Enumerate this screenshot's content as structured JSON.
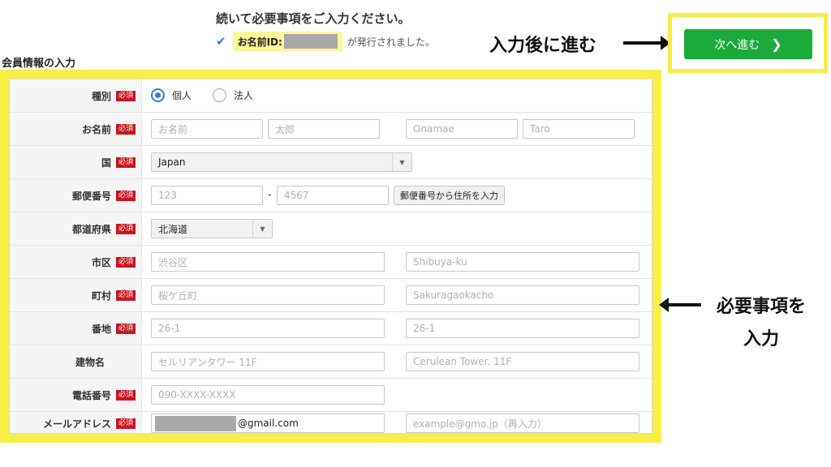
{
  "header": {
    "heading": "続いて必要事項をご入力ください。",
    "notice_label": "お名前ID:",
    "notice_suffix": "が発行されました。"
  },
  "annotations": {
    "next": "入力後に進む",
    "required_line1": "必要事項を",
    "required_line2": "入力"
  },
  "next_button": {
    "label": "次へ進む",
    "color": "#1aab3c"
  },
  "highlight_color": "#f7ee48",
  "section_title": "会員情報の入力",
  "required_badge": "必須",
  "form": {
    "type": {
      "label": "種別",
      "options": [
        "個人",
        "法人"
      ],
      "selected": "個人"
    },
    "name": {
      "label": "お名前",
      "last_placeholder": "お名前",
      "first_placeholder": "太郎",
      "last_roman_placeholder": "Onamae",
      "first_roman_placeholder": "Taro"
    },
    "country": {
      "label": "国",
      "value": "Japan"
    },
    "postal": {
      "label": "郵便番号",
      "part1_placeholder": "123",
      "separator": "-",
      "part2_placeholder": "4567",
      "lookup_button": "郵便番号から住所を入力"
    },
    "prefecture": {
      "label": "都道府県",
      "value": "北海道"
    },
    "city": {
      "label": "市区",
      "placeholder": "渋谷区",
      "roman_placeholder": "Shibuya-ku"
    },
    "town": {
      "label": "町村",
      "placeholder": "桜ケ丘町",
      "roman_placeholder": "Sakuragaokacho"
    },
    "address": {
      "label": "番地",
      "placeholder": "26-1",
      "roman_placeholder": "26-1"
    },
    "building": {
      "label": "建物名",
      "placeholder": "セルリアンタワー 11F",
      "roman_placeholder": "Cerulean Tower. 11F"
    },
    "phone": {
      "label": "電話番号",
      "placeholder": "090-XXXX-XXXX"
    },
    "email": {
      "label": "メールアドレス",
      "value_suffix": "@gmail.com",
      "confirm_placeholder": "example@gmo.jp（再入力）"
    }
  }
}
